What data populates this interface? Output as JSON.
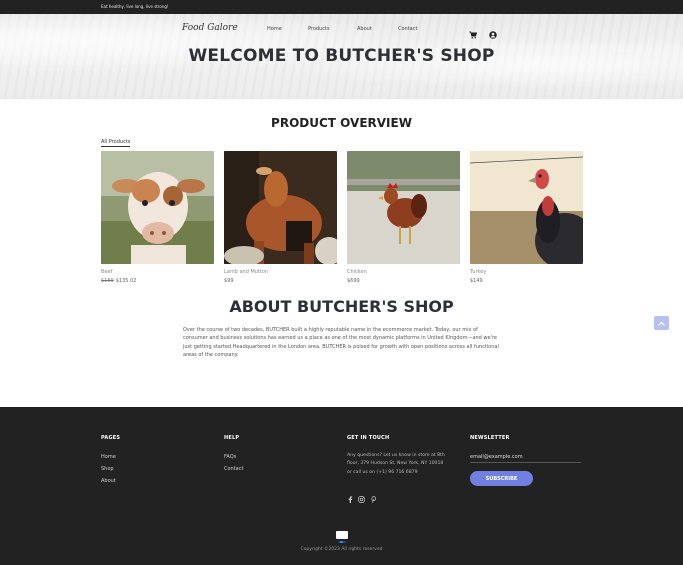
{
  "topbar": {
    "text": "Eat healthy, live long, live strong!"
  },
  "header": {
    "logo": "Food Galore",
    "nav": [
      "Home",
      "Products",
      "About",
      "Contact"
    ],
    "icons": [
      "cart-icon",
      "user-icon"
    ]
  },
  "hero": {
    "title": "WELCOME TO BUTCHER'S SHOP"
  },
  "products_section": {
    "title": "PRODUCT OVERVIEW",
    "filter": "All Products",
    "items": [
      {
        "name": "Beef",
        "old_price": "$169",
        "price": "$135.02",
        "image": "cow-photo"
      },
      {
        "name": "Lamb and Mutton",
        "old_price": "",
        "price": "$99",
        "image": "goat-photo"
      },
      {
        "name": "Chicken",
        "old_price": "",
        "price": "$699",
        "image": "hen-photo"
      },
      {
        "name": "Turkey",
        "old_price": "",
        "price": "$149",
        "image": "turkey-photo"
      }
    ]
  },
  "about": {
    "title": "ABOUT BUTCHER'S SHOP",
    "text": "Over the course of two decades, BUTCHER built a highly reputable name in the ecommerce market. Today, our mix of consumer and business solutions has earned us a place as one of the most dynamic platforms in United Kingdom—and we're just getting started.Headquartered in the London area, BUTCHER is poised for growth with open positions across all functional areas of the company."
  },
  "footer": {
    "pages": {
      "title": "PAGES",
      "links": [
        "Home",
        "Shop",
        "About"
      ]
    },
    "help": {
      "title": "HELP",
      "links": [
        "FAQs",
        "Contact"
      ]
    },
    "contact": {
      "title": "GET IN TOUCH",
      "text": "Any questions? Let us know in store at 8th floor, 379 Hudson St, New York, NY 10018 or call us on (+1) 96 716 6879",
      "social": [
        "facebook-icon",
        "instagram-icon",
        "pinterest-icon"
      ]
    },
    "newsletter": {
      "title": "NEWSLETTER",
      "placeholder": "email@example.com",
      "button": "SUBSCRIBE"
    },
    "payment_icon": "paypal-icon",
    "copyright": "Copyright ©2023 All rights reserved"
  },
  "colors": {
    "accent": "#717fe0",
    "dark": "#222222",
    "scroll_button": "#b7c0f0"
  }
}
